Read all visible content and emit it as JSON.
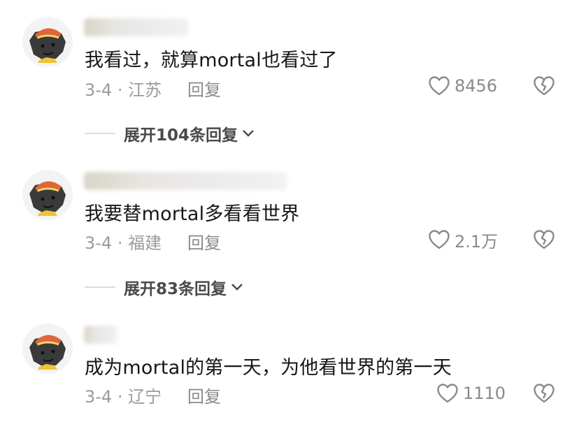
{
  "comments": [
    {
      "text": "我看过，就算mortal也看过了",
      "meta": "3-4 · 江苏",
      "reply_label": "回复",
      "likes": "8456",
      "expand_label": "展开104条回复"
    },
    {
      "text": "我要替mortal多看看世界",
      "meta": "3-4 · 福建",
      "reply_label": "回复",
      "likes": "2.1万",
      "expand_label": "展开83条回复"
    },
    {
      "text": "成为mortal的第一天，为他看世界的第一天",
      "meta": "3-4 · 辽宁",
      "reply_label": "回复",
      "likes": "1110"
    }
  ],
  "icons": {
    "like": "heart-outline-icon",
    "dislike": "broken-heart-icon",
    "expand": "chevron-down-icon"
  },
  "colors": {
    "text": "#161616",
    "meta": "#9b9b9b",
    "icon": "#8a8a8a"
  }
}
